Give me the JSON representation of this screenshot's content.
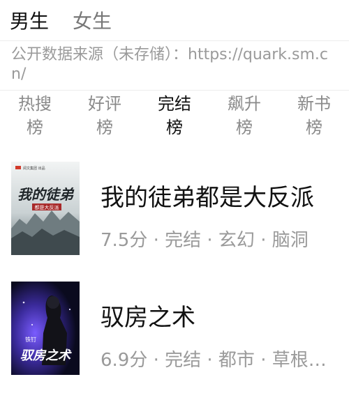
{
  "gender_tabs": {
    "male": "男生",
    "female": "女生"
  },
  "source_note": "公开数据来源（未存储）：https://quark.sm.cn/",
  "rank_tabs": [
    {
      "line1": "热搜",
      "line2": "榜"
    },
    {
      "line1": "好评",
      "line2": "榜"
    },
    {
      "line1": "完结",
      "line2": "榜"
    },
    {
      "line1": "飙升",
      "line2": "榜"
    },
    {
      "line1": "新书",
      "line2": "榜"
    }
  ],
  "books": [
    {
      "title": "我的徒弟都是大反派",
      "meta": "7.5分 · 完结 · 玄幻 · 脑洞",
      "cover": {
        "title": "我的徒弟",
        "subtitle": "都是大反派",
        "publisher": "阅文集团 出品"
      }
    },
    {
      "title": "驭房之术",
      "meta": "6.9分 · 完结 · 都市 · 草根逆...",
      "cover": {
        "title": "驭房之术",
        "author": "铁钉"
      }
    }
  ],
  "colors": {
    "active": "#111111",
    "inactive": "#8a8a8a",
    "note": "#9a9a9a"
  }
}
